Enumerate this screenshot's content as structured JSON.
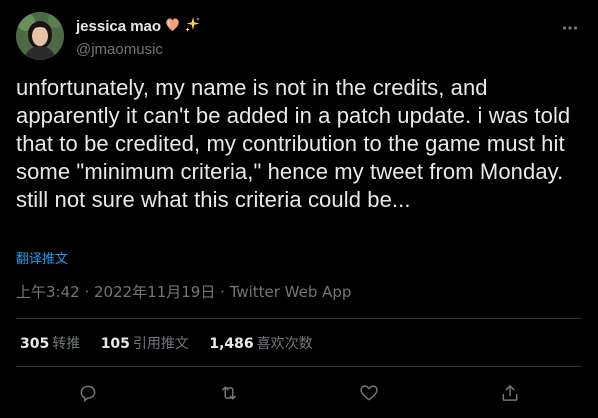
{
  "author": {
    "display_name": "jessica mao",
    "handle": "@jmaomusic",
    "name_emojis": [
      "peach-heart-icon",
      "sparkles-icon"
    ]
  },
  "tweet": {
    "text": "unfortunately, my name is not in the credits, and apparently it can't be added in a patch update. i was told that to be credited, my contribution to the game must hit some \"minimum criteria,\" hence my tweet from Monday. still not sure what this criteria could be...",
    "translate_label": "翻译推文",
    "timestamp": "上午3:42 · 2022年11月19日 · Twitter Web App"
  },
  "stats": {
    "retweets_count": "305",
    "retweets_label": "转推",
    "quotes_count": "105",
    "quotes_label": "引用推文",
    "likes_count": "1,486",
    "likes_label": "喜欢次数"
  },
  "actions": [
    "reply-icon",
    "retweet-icon",
    "like-icon",
    "share-icon"
  ],
  "colors": {
    "background": "#000000",
    "text": "#e7e9ea",
    "secondary": "#71767b",
    "link": "#1d9bf0",
    "divider": "#2f3336"
  }
}
